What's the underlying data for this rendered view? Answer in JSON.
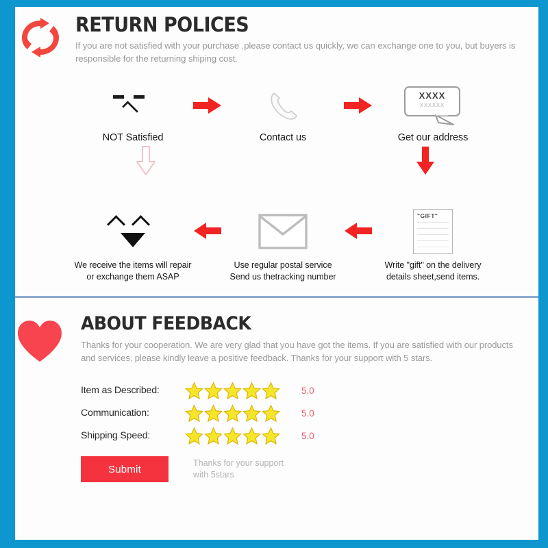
{
  "theme": {
    "frame_color": "#0d97ce",
    "card_bg": "#fdfdfd",
    "accent_red": "#f5333f",
    "divider_color": "#6a8fc0",
    "star_color": "#f5e132",
    "rating_value_color": "#e8616d",
    "muted_text": "#9a9a9a"
  },
  "return_section": {
    "icon": "refresh-arrows-icon",
    "title": "RETURN POLICES",
    "description": "If you are not satisfied with your purchase .please contact us quickly, we can exchange one to you, but buyers is responsible for the returning shiping cost.",
    "row1": [
      {
        "icon": "sad-face-icon",
        "label": "NOT Satisfied"
      },
      {
        "icon": "arrow-right-icon"
      },
      {
        "icon": "telephone-icon",
        "label": "Contact us"
      },
      {
        "icon": "arrow-right-icon"
      },
      {
        "icon": "speech-bubble-icon",
        "label": "Get our address",
        "bubble_line1": "XXXX",
        "bubble_line2": "xxxxxx"
      }
    ],
    "mid_arrows": [
      {
        "icon": "arrow-down-outline-icon"
      },
      {
        "icon": "arrow-down-solid-icon"
      }
    ],
    "row2": [
      {
        "icon": "happy-face-icon",
        "label_line1": "We receive the items will repair",
        "label_line2": "or exchange them ASAP"
      },
      {
        "icon": "arrow-left-icon"
      },
      {
        "icon": "envelope-icon",
        "label_line1": "Use regular postal service",
        "label_line2": "Send us thetracking number"
      },
      {
        "icon": "arrow-left-icon"
      },
      {
        "icon": "gift-document-icon",
        "doc_label": "\"GIFT\"",
        "label_line1": "Write \"gift\" on the delivery",
        "label_line2": "details sheet,send items."
      }
    ]
  },
  "feedback_section": {
    "icon": "heart-icon",
    "title": "ABOUT FEEDBACK",
    "description": "Thanks for your cooperation. We are very glad that you have got the items. If you are satisfied with our products and services, please kindly leave a positive feedback. Thanks for your support with 5 stars.",
    "ratings": [
      {
        "label": "Item as Described:",
        "stars": 5,
        "value": "5.0"
      },
      {
        "label": "Communication:",
        "stars": 5,
        "value": "5.0"
      },
      {
        "label": "Shipping Speed:",
        "stars": 5,
        "value": "5.0"
      }
    ],
    "submit_label": "Submit",
    "submit_note_line1": "Thanks for your support",
    "submit_note_line2": "with 5stars"
  }
}
